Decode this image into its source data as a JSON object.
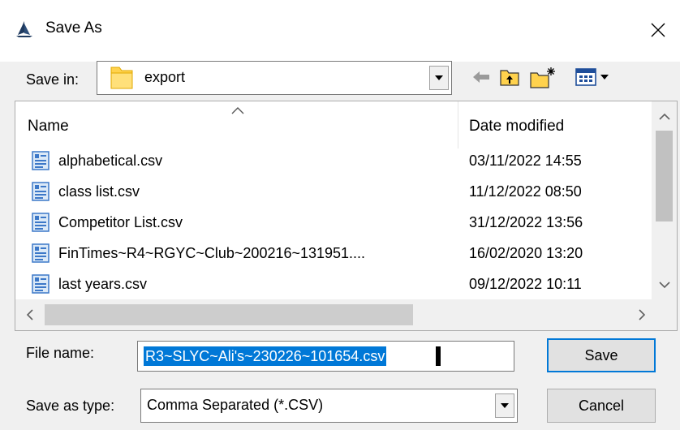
{
  "window": {
    "title": "Save As",
    "icon": "sailboat-icon"
  },
  "save_in": {
    "label": "Save in:",
    "value": "export",
    "icon": "folder-icon"
  },
  "toolbar": {
    "back_icon": "back-arrow-icon",
    "up_icon": "up-folder-icon",
    "new_folder_icon": "new-folder-icon",
    "view_icon": "view-menu-icon"
  },
  "file_list": {
    "columns": [
      "Name",
      "Date modified"
    ],
    "rows": [
      {
        "name": "alphabetical.csv",
        "date": "03/11/2022 14:55"
      },
      {
        "name": "class list.csv",
        "date": "11/12/2022 08:50"
      },
      {
        "name": "Competitor List.csv",
        "date": "31/12/2022 13:56"
      },
      {
        "name": "FinTimes~R4~RGYC~Club~200216~131951....",
        "date": "16/02/2020 13:20"
      },
      {
        "name": "last years.csv",
        "date": "09/12/2022 10:11"
      }
    ]
  },
  "file_name": {
    "label": "File name:",
    "value": "R3~SLYC~Ali's~230226~101654.csv"
  },
  "save_as_type": {
    "label": "Save as type:",
    "value": "Comma Separated (*.CSV)"
  },
  "buttons": {
    "save": "Save",
    "cancel": "Cancel"
  },
  "colors": {
    "selection": "#0078d7",
    "window_bg": "#f0f0f0",
    "accent_border": "#0078d7"
  }
}
